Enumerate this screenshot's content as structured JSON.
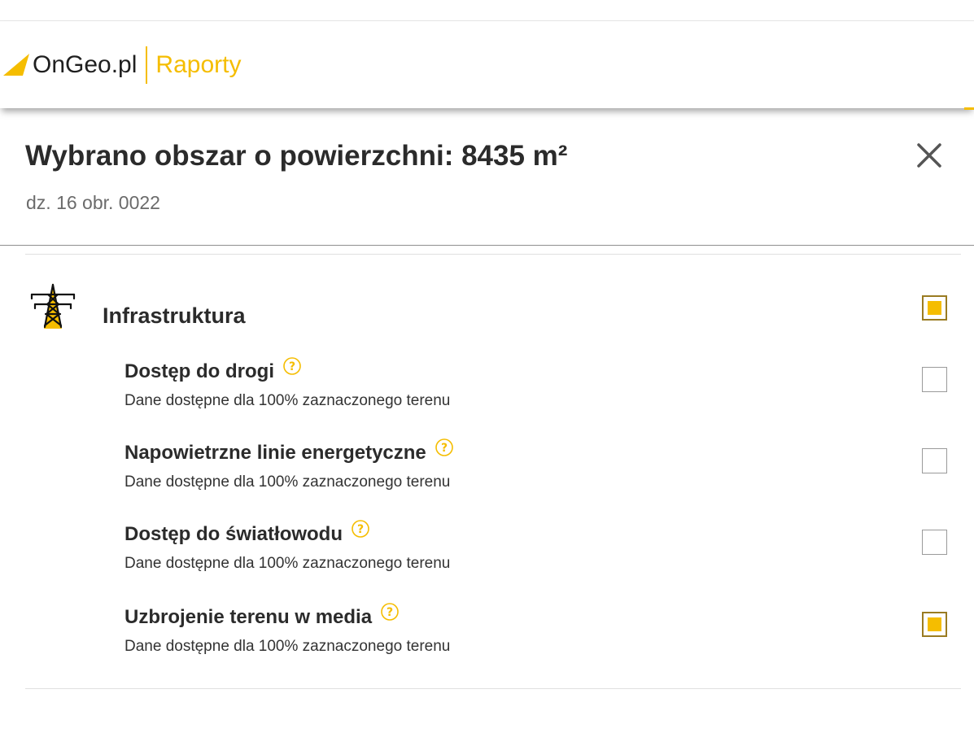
{
  "brand": {
    "name": "OnGeo.pl",
    "section": "Raporty",
    "accent_color": "#f5bd00"
  },
  "panel": {
    "title": "Wybrano obszar o powierzchni: 8435 m²",
    "subtitle": "dz. 16 obr. 0022",
    "close_icon": "close-icon"
  },
  "section": {
    "title": "Infrastruktura",
    "icon": "power-pylon-icon",
    "checked": true,
    "items": [
      {
        "title": "Dostęp do drogi",
        "description": "Dane dostępne dla 100% zaznaczonego terenu",
        "checked": false
      },
      {
        "title": "Napowietrzne linie energetyczne",
        "description": "Dane dostępne dla 100% zaznaczonego terenu",
        "checked": false
      },
      {
        "title": "Dostęp do światłowodu",
        "description": "Dane dostępne dla 100% zaznaczonego terenu",
        "checked": false
      },
      {
        "title": "Uzbrojenie terenu w media",
        "description": "Dane dostępne dla 100% zaznaczonego terenu",
        "checked": true
      }
    ]
  }
}
